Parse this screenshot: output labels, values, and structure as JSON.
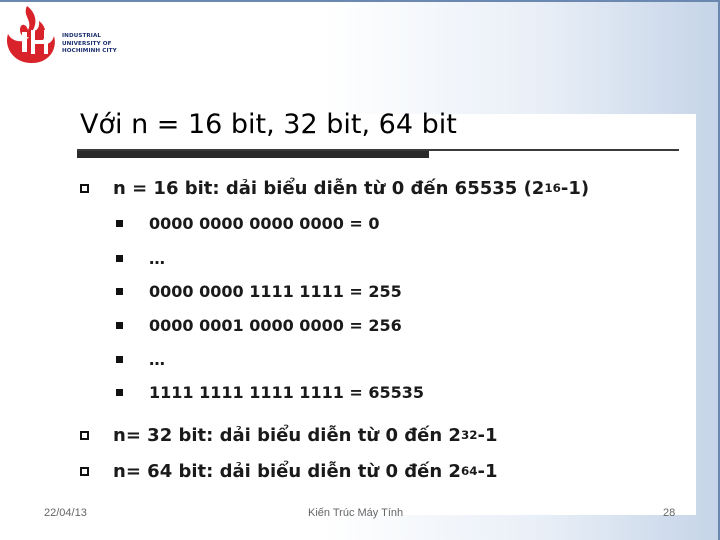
{
  "logo": {
    "lines": [
      "INDUSTRIAL",
      "UNIVERSITY OF",
      "HOCHIMINH CITY"
    ],
    "brand_color": "#d8232a",
    "text_color": "#1b2f6e"
  },
  "slide": {
    "title": "Với n = 16 bit, 32 bit, 64 bit",
    "items": [
      {
        "level": 1,
        "prefix": "n = 16 bit: dải biểu diễn từ 0 đến 65535 (2",
        "sup": "16",
        "suffix": "-1)"
      },
      {
        "level": 2,
        "text": "0000 0000 0000 0000 = 0"
      },
      {
        "level": 2,
        "text": "…"
      },
      {
        "level": 2,
        "text": "0000 0000 1111 1111 = 255"
      },
      {
        "level": 2,
        "text": "0000 0001 0000 0000 = 256"
      },
      {
        "level": 2,
        "text": "…"
      },
      {
        "level": 2,
        "text": "1111 1111 1111 1111 = 65535"
      },
      {
        "level": 1,
        "prefix": "n= 32 bit: dải biểu diễn từ 0 đến 2",
        "sup": "32",
        "suffix": "-1"
      },
      {
        "level": 1,
        "prefix": "n= 64 bit: dải biểu diễn từ 0 đến 2",
        "sup": "64",
        "suffix": "-1"
      }
    ]
  },
  "footer": {
    "date": "22/04/13",
    "course": "Kiến Trúc Máy Tính",
    "page": "28"
  }
}
